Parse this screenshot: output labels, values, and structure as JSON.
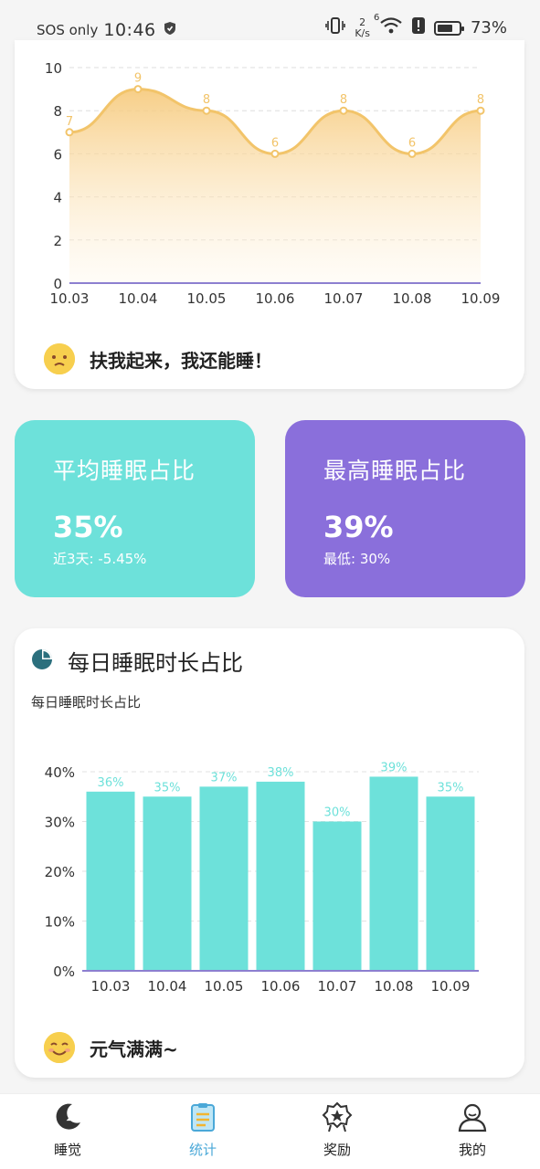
{
  "status_bar": {
    "carrier": "SOS only",
    "time": "10:46",
    "net_speed_value": "2",
    "net_speed_unit": "K/s",
    "wifi_badge": "6",
    "battery": "73%",
    "battery_level": 0.73
  },
  "card_sleep_chart": {
    "mood_text": "扶我起来，我还能睡！"
  },
  "stats": {
    "average": {
      "title": "平均睡眠占比",
      "value": "35%",
      "sub": "近3天: -5.45%"
    },
    "highest": {
      "title": "最高睡眠占比",
      "value": "39%",
      "sub": "最低: 30%"
    }
  },
  "card_ratio": {
    "title": "每日睡眠时长占比",
    "caption": "每日睡眠时长占比",
    "mood_text": "元气满满~"
  },
  "colors": {
    "teal": "#6de1da",
    "purple": "#8a6fdb",
    "area_line": "#f2c46a",
    "nav_active": "#4aa8d8"
  },
  "nav": [
    {
      "label": "睡觉",
      "icon": "moon-icon"
    },
    {
      "label": "统计",
      "icon": "clipboard-icon"
    },
    {
      "label": "奖励",
      "icon": "badge-icon"
    },
    {
      "label": "我的",
      "icon": "user-icon"
    }
  ],
  "chart_data": [
    {
      "type": "area",
      "categories": [
        "10.03",
        "10.04",
        "10.05",
        "10.06",
        "10.07",
        "10.08",
        "10.09"
      ],
      "values": [
        7,
        9,
        8,
        6,
        8,
        6,
        8
      ],
      "ylim": [
        0,
        10
      ],
      "yticks": [
        0,
        2,
        4,
        6,
        8,
        10
      ],
      "data_labels": true,
      "grid": true
    },
    {
      "type": "bar",
      "categories": [
        "10.03",
        "10.04",
        "10.05",
        "10.06",
        "10.07",
        "10.08",
        "10.09"
      ],
      "values": [
        36,
        35,
        37,
        38,
        30,
        39,
        35
      ],
      "value_labels": [
        "36%",
        "35%",
        "37%",
        "38%",
        "30%",
        "39%",
        "35%"
      ],
      "ylim": [
        0,
        40
      ],
      "yticks": [
        "0%",
        "10%",
        "20%",
        "30%",
        "40%"
      ],
      "grid": true
    }
  ]
}
